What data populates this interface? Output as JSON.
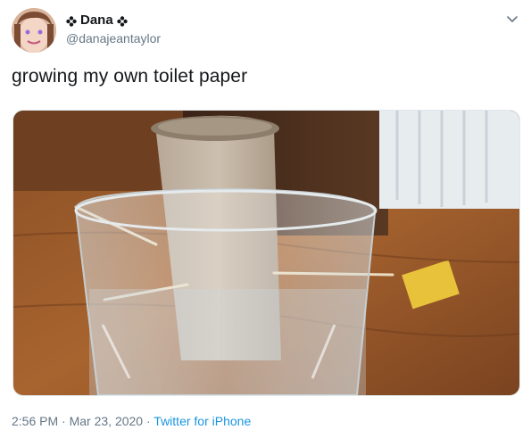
{
  "user": {
    "name": "Dana",
    "handle": "@danajeantaylor"
  },
  "tweet": {
    "text": "growing my own toilet paper"
  },
  "meta": {
    "time": "2:56 PM",
    "separator": "·",
    "date": "Mar 23, 2020",
    "source": "Twitter for iPhone"
  },
  "icons": {
    "badge": "flower-icon",
    "menu": "chevron-down-icon"
  },
  "colors": {
    "text": "#14171a",
    "secondary": "#657786",
    "link": "#1b95e0"
  }
}
